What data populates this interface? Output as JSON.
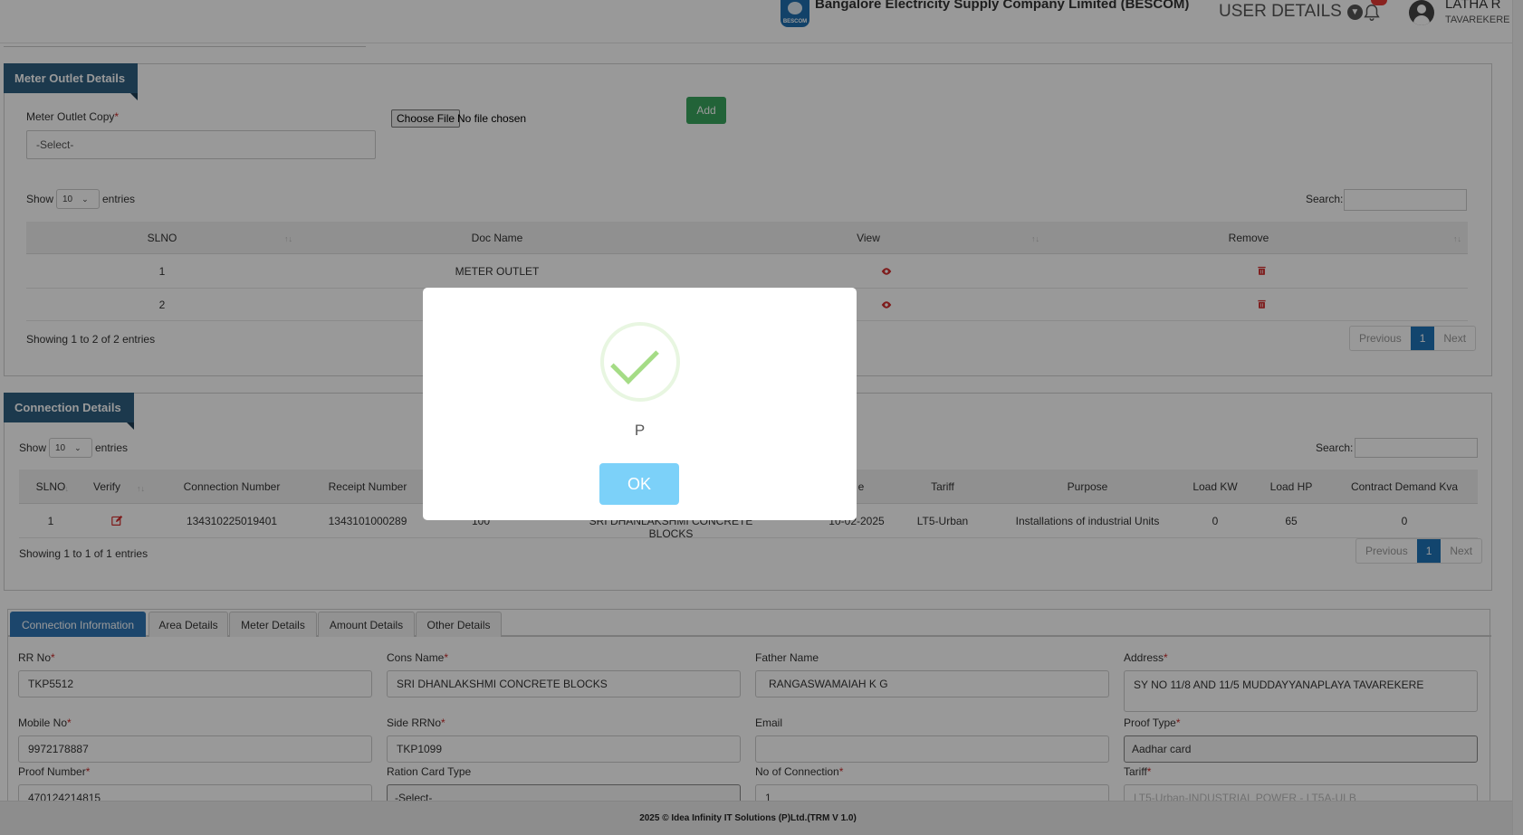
{
  "header": {
    "company": "Bangalore Electricity Supply Company Limited (BESCOM)",
    "logo_text": "BESCOM",
    "user_details": "USER DETAILS",
    "user_name": "LATHA R",
    "user_location": "TAVAREKERE"
  },
  "meter_outlet": {
    "title": "Meter Outlet Details",
    "copy_label": "Meter Outlet Copy",
    "copy_select": "-Select-",
    "choose_file": "Choose File",
    "no_file": "No file chosen",
    "add_label": "Add",
    "show_label": "Show",
    "entries_count": "10",
    "entries_label": "entries",
    "search_label": "Search:",
    "columns": [
      "SLNO",
      "Doc Name",
      "View",
      "Remove"
    ],
    "rows": [
      {
        "slno": "1",
        "doc": "METER OUTLET"
      },
      {
        "slno": "2",
        "doc": ""
      }
    ],
    "info": "Showing 1 to 2 of 2 entries",
    "pager": {
      "prev": "Previous",
      "page": "1",
      "next": "Next"
    }
  },
  "connection": {
    "title": "Connection Details",
    "show_label": "Show",
    "entries_count": "10",
    "entries_label": "entries",
    "search_label": "Search:",
    "columns": [
      "SLNO",
      "Verify",
      "Connection Number",
      "Receipt Number",
      "",
      "",
      "e",
      "Tariff",
      "Purpose",
      "Load KW",
      "Load HP",
      "Contract Demand Kva"
    ],
    "row": {
      "slno": "1",
      "connection_number": "134310225019401",
      "receipt_number": "1343101000289",
      "partial_1": "100",
      "partial_2": "SRI DHANLAKSHMI CONCRETE BLOCKS",
      "partial_3": "10-02-2025",
      "tariff": "LT5-Urban",
      "purpose": "Installations of industrial Units",
      "load_kw": "0",
      "load_hp": "65",
      "contract_demand": "0"
    },
    "info": "Showing 1 to 1 of 1 entries",
    "pager": {
      "prev": "Previous",
      "page": "1",
      "next": "Next"
    }
  },
  "tabs": [
    "Connection Information",
    "Area Details",
    "Meter Details",
    "Amount Details",
    "Other Details"
  ],
  "form": {
    "rr_no_label": "RR No",
    "rr_no": "TKP5512",
    "cons_name_label": "Cons Name",
    "cons_name": "SRI DHANLAKSHMI CONCRETE BLOCKS",
    "father_label": "Father Name",
    "father": "RANGASWAMAIAH K G",
    "address_label": "Address",
    "address": "SY NO 11/8 AND 11/5 MUDDAYYANAPLAYA  TAVAREKERE",
    "mobile_label": "Mobile No",
    "mobile": "9972178887",
    "side_rr_label": "Side RRNo",
    "side_rr": "TKP1099",
    "email_label": "Email",
    "email": "",
    "proof_type_label": "Proof Type",
    "proof_type": "Aadhar card",
    "proof_number_label": "Proof Number",
    "proof_number": "470124214815",
    "ration_label": "Ration Card Type",
    "ration": "-Select-",
    "no_conn_label": "No of Connection",
    "no_conn": "1",
    "tariff_label": "Tariff",
    "tariff": "LT5-Urban-INDUSTRIAL POWER - LT5A-ULB"
  },
  "footer": "2025 © Idea Infinity IT Solutions (P)Ltd.(TRM V 1.0)",
  "modal": {
    "message": "P",
    "ok_label": "OK"
  },
  "colors": {
    "ribbon": "#2f5f80",
    "add_button": "#3aa55e",
    "pager_active": "#1f73b7",
    "ok_button": "#7cd1f9",
    "success_check": "#a5dc86",
    "required": "#c62828"
  }
}
